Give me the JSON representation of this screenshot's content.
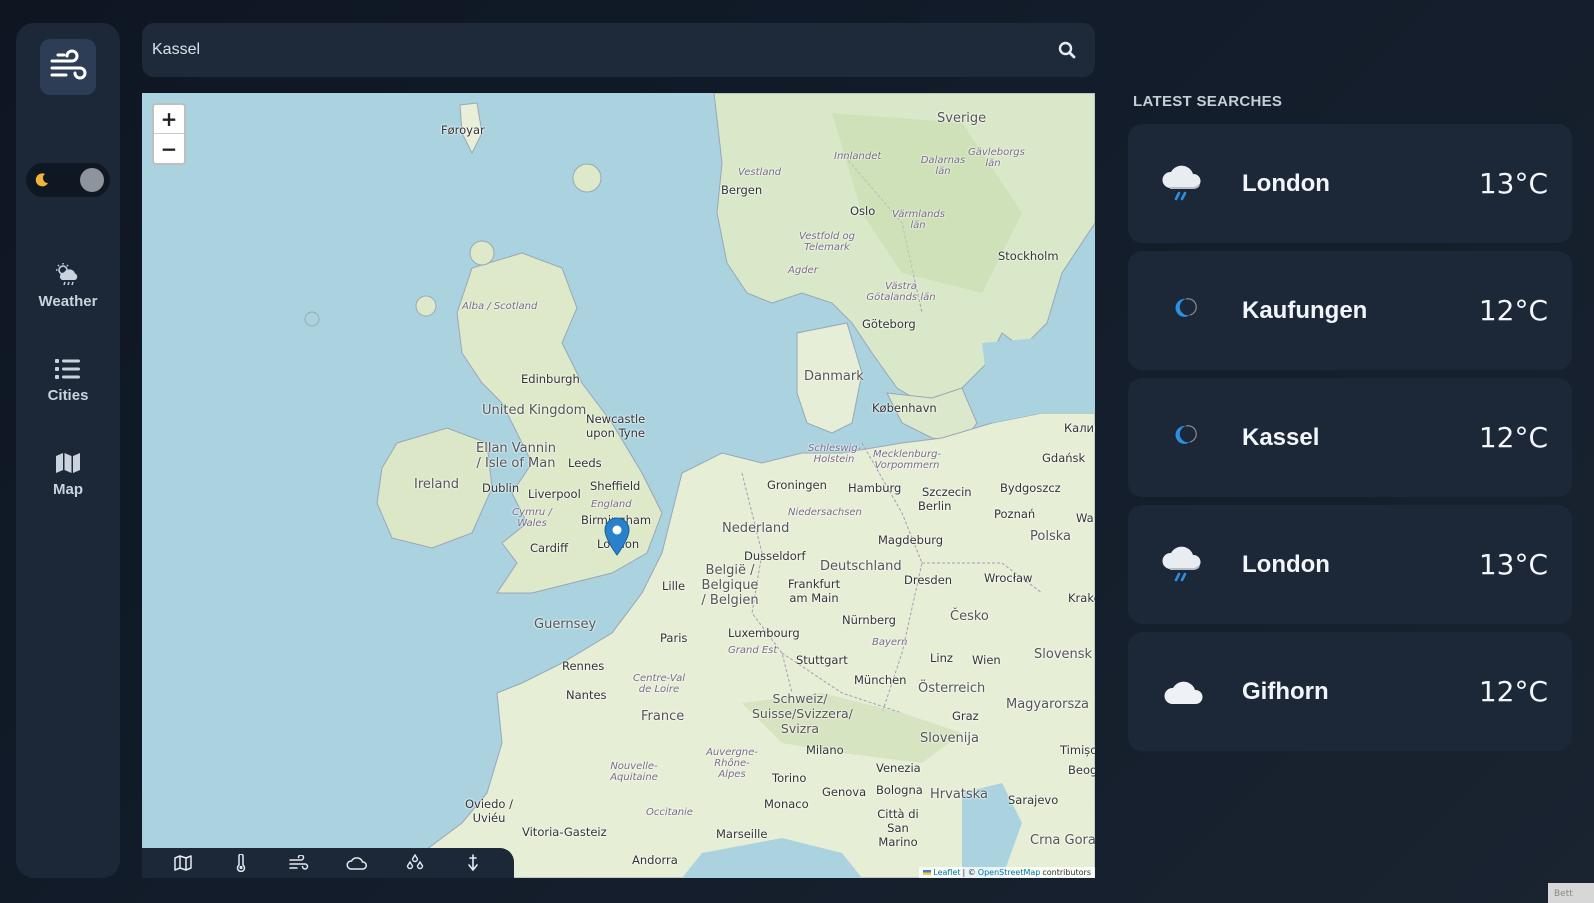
{
  "sidebar": {
    "logo_icon": "wind-icon",
    "theme_toggle": {
      "icon": "moon-icon",
      "mode": "dark"
    },
    "nav": [
      {
        "label": "Weather",
        "icon": "cloud-sun-rain-icon"
      },
      {
        "label": "Cities",
        "icon": "list-icon"
      },
      {
        "label": "Map",
        "icon": "map-icon"
      }
    ]
  },
  "search": {
    "value": "Kassel",
    "icon": "search-icon"
  },
  "map": {
    "zoom_in": "+",
    "zoom_out": "−",
    "marker_location": "London",
    "labels": {
      "foroyar": "Føroyar",
      "sverige": "Sverige",
      "vestland": "Vestland",
      "innlandet": "Innlandet",
      "dalarnas": "Dalarnas län",
      "gavleborgs": "Gävleborgs län",
      "bergen": "Bergen",
      "oslo": "Oslo",
      "varmlands": "Värmlands län",
      "vestfold": "Vestfold og Telemark",
      "agder": "Agder",
      "stockholm": "Stockholm",
      "vastra": "Västra Götalands län",
      "alba": "Alba / Scotland",
      "goteborg": "Göteborg",
      "danmark": "Danmark",
      "kobenhavn": "København",
      "edinburgh": "Edinburgh",
      "uk": "United Kingdom",
      "newcastle": "Newcastle upon Tyne",
      "ellan": "Ellan Vannin / Isle of Man",
      "leeds": "Leeds",
      "kalin": "Калин",
      "ireland": "Ireland",
      "dublin": "Dublin",
      "liverpool": "Liverpool",
      "sheffield": "Sheffield",
      "england": "England",
      "schleswig": "Schleswig-Holstein",
      "mecklenburg": "Mecklenburg-Vorpommern",
      "gdansk": "Gdańsk",
      "groningen": "Groningen",
      "hamburg": "Hamburg",
      "szczecin": "Szczecin",
      "bydgoszcz": "Bydgoszcz",
      "cymru": "Cymru / Wales",
      "birmingham": "Birmingham",
      "nedersachsen": "Niedersachsen",
      "berlin": "Berlin",
      "poznan": "Poznań",
      "nederland": "Nederland",
      "wa": "Wa",
      "cardiff": "Cardiff",
      "london": "London",
      "magdeburg": "Magdeburg",
      "polska": "Polska",
      "dusseldorf": "Dusseldorf",
      "deutschland": "Deutschland",
      "belgie": "België / Belgique / Belgien",
      "lille": "Lille",
      "frankfurt": "Frankfurt am Main",
      "dresden": "Dresden",
      "wroclaw": "Wrocław",
      "krakow": "Krakó",
      "guernsey": "Guernsey",
      "paris": "Paris",
      "luxembourg": "Luxembourg",
      "nurnberg": "Nürnberg",
      "cesko": "Česko",
      "grandest": "Grand Est",
      "bayern": "Bayern",
      "rennes": "Rennes",
      "stuttgart": "Stuttgart",
      "linz": "Linz",
      "wien": "Wien",
      "slovensk": "Slovensk",
      "centreval": "Centre-Val de Loire",
      "nantes": "Nantes",
      "munchen": "München",
      "osterreich": "Österreich",
      "magyarorszag": "Magyarorsza",
      "france": "France",
      "schweiz": "Schweiz/ Suisse/Svizzera/ Svizra",
      "graz": "Graz",
      "slovenija": "Slovenija",
      "milano": "Milano",
      "auvergne": "Auvergne-Rhône-Alpes",
      "venezia": "Venezia",
      "timis": "Timișo",
      "nouvelle": "Nouvelle-Aquitaine",
      "torino": "Torino",
      "hrvatska": "Hrvatska",
      "beog": "Beog",
      "oviedo": "Oviedo / Uviéu",
      "monaco": "Monaco",
      "genova": "Genova",
      "bologna": "Bologna",
      "sarajevo": "Sarajevo",
      "occitanie": "Occitanie",
      "citta": "Città di San Marino",
      "vitoria": "Vitoria-Gasteiz",
      "marseille": "Marseille",
      "crnagora": "Crna Gora",
      "andorra": "Andorra"
    },
    "attribution": {
      "leaflet": "Leaflet",
      "sep": "| ©",
      "osm": "OpenStreetMap",
      "suffix": "contributors"
    },
    "layers": [
      {
        "icon": "map-icon"
      },
      {
        "icon": "thermometer-icon"
      },
      {
        "icon": "wind-icon"
      },
      {
        "icon": "cloud-icon"
      },
      {
        "icon": "droplets-icon"
      },
      {
        "icon": "pressure-arrow-icon"
      }
    ]
  },
  "latest": {
    "title": "LATEST SEARCHES",
    "items": [
      {
        "city": "London",
        "temp": "13°C",
        "icon": "cloud-rain-icon"
      },
      {
        "city": "Kaufungen",
        "temp": "12°C",
        "icon": "moon-icon"
      },
      {
        "city": "Kassel",
        "temp": "12°C",
        "icon": "moon-icon"
      },
      {
        "city": "London",
        "temp": "13°C",
        "icon": "cloud-rain-icon"
      },
      {
        "city": "Gifhorn",
        "temp": "12°C",
        "icon": "moon-cloud-icon"
      }
    ]
  },
  "colors": {
    "background": "#121c2a",
    "panel": "#1c2838",
    "sea": "#aad3df",
    "land": "#e8f0d8",
    "accent": "#2d8fe0",
    "moon_toggle": "#f0b43a"
  },
  "corner_tag": "Bett"
}
